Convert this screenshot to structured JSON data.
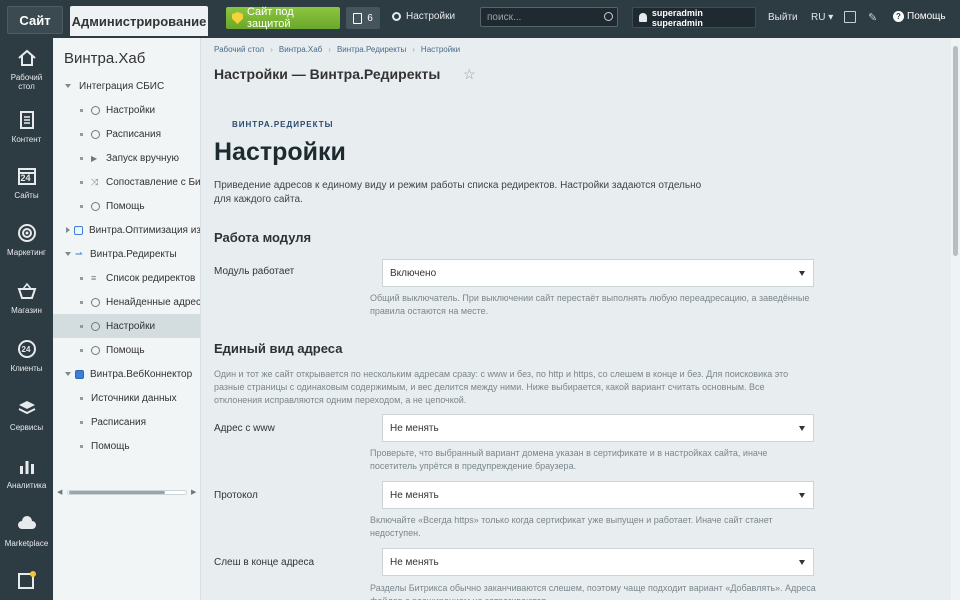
{
  "topbar": {
    "site_tab": "Сайт",
    "admin_tab": "Администрирование",
    "protect_button": "Сайт под защитой",
    "notifications_count": "6",
    "settings_label": "Настройки",
    "search_placeholder": "поиск...",
    "user_name": "superadmin superadmin",
    "logout_label": "Выйти",
    "lang_label": "RU",
    "help_label": "Помощь"
  },
  "leftbar": {
    "items": [
      {
        "label1": "Рабочий",
        "label2": "стол",
        "icon": "home-icon"
      },
      {
        "label1": "Контент",
        "label2": "",
        "icon": "document-icon"
      },
      {
        "label1": "Сайты",
        "label2": "",
        "icon": "calendar-icon",
        "badge": "24"
      },
      {
        "label1": "Маркетинг",
        "label2": "",
        "icon": "target-icon"
      },
      {
        "label1": "Магазин",
        "label2": "",
        "icon": "basket-icon"
      },
      {
        "label1": "Клиенты",
        "label2": "",
        "icon": "clients-icon",
        "badge": "24"
      },
      {
        "label1": "Сервисы",
        "label2": "",
        "icon": "layers-icon"
      },
      {
        "label1": "Аналитика",
        "label2": "",
        "icon": "chart-icon"
      },
      {
        "label1": "Marketplace",
        "label2": "",
        "icon": "cloud-icon"
      },
      {
        "label1": "",
        "label2": "",
        "icon": "magic-icon"
      }
    ]
  },
  "tree": {
    "title": "Винтра.Хаб",
    "nodes": [
      {
        "label": "Интеграция СБИС",
        "level": 0,
        "arrow": "down"
      },
      {
        "label": "Настройки",
        "level": 1
      },
      {
        "label": "Расписания",
        "level": 1
      },
      {
        "label": "Запуск вручную",
        "level": 1
      },
      {
        "label": "Сопоставление с Битри",
        "level": 1
      },
      {
        "label": "Помощь",
        "level": 1
      },
      {
        "label": "Винтра.Оптимизация изоб",
        "level": 0,
        "arrow": "right"
      },
      {
        "label": "Винтра.Редиректы",
        "level": 0,
        "arrow": "down"
      },
      {
        "label": "Список редиректов",
        "level": 1
      },
      {
        "label": "Ненайденные адреса",
        "level": 1
      },
      {
        "label": "Настройки",
        "level": 1,
        "active": true
      },
      {
        "label": "Помощь",
        "level": 1
      },
      {
        "label": "Винтра.ВебКоннектор",
        "level": 0,
        "arrow": "down"
      },
      {
        "label": "Источники данных",
        "level": 1
      },
      {
        "label": "Расписания",
        "level": 1
      },
      {
        "label": "Помощь",
        "level": 1
      }
    ]
  },
  "breadcrumb": [
    "Рабочий стол",
    "Винтра.Хаб",
    "Винтра.Редиректы",
    "Настройки"
  ],
  "page_title": "Настройки — Винтра.Редиректы",
  "module_tag": "ВИНТРА.РЕДИРЕКТЫ",
  "heading": "Настройки",
  "lead": "Приведение адресов к единому виду и режим работы списка редиректов. Настройки задаются отдельно для каждого сайта.",
  "sections": {
    "module": {
      "title": "Работа модуля",
      "field_label": "Модуль работает",
      "field_value": "Включено",
      "hint": "Общий выключатель. При выключении сайт перестаёт выполнять любую переадресацию, а заведённые правила остаются на месте."
    },
    "address": {
      "title": "Единый вид адреса",
      "desc": "Один и тот же сайт открывается по нескольким адресам сразу: с www и без, по http и https, со слешем в конце и без. Для поисковика это разные страницы с одинаковым содержимым, и вес делится между ними. Ниже выбирается, какой вариант считать основным. Все отклонения исправляются одним переходом, а не цепочкой.",
      "www_label": "Адрес с www",
      "www_value": "Не менять",
      "www_hint": "Проверьте, что выбранный вариант домена указан в сертификате и в настройках сайта, иначе посетитель упрётся в предупреждение браузера.",
      "protocol_label": "Протокол",
      "protocol_value": "Не менять",
      "protocol_hint": "Включайте «Всегда https» только когда сертификат уже выпущен и работает. Иначе сайт станет недоступен.",
      "slash_label": "Слеш в конце адреса",
      "slash_value": "Не менять",
      "slash_hint": "Разделы Битрикса обычно заканчиваются слешем, поэтому чаще подходит вариант «Добавлять». Адреса файлов с расширением не затрагиваются."
    }
  }
}
